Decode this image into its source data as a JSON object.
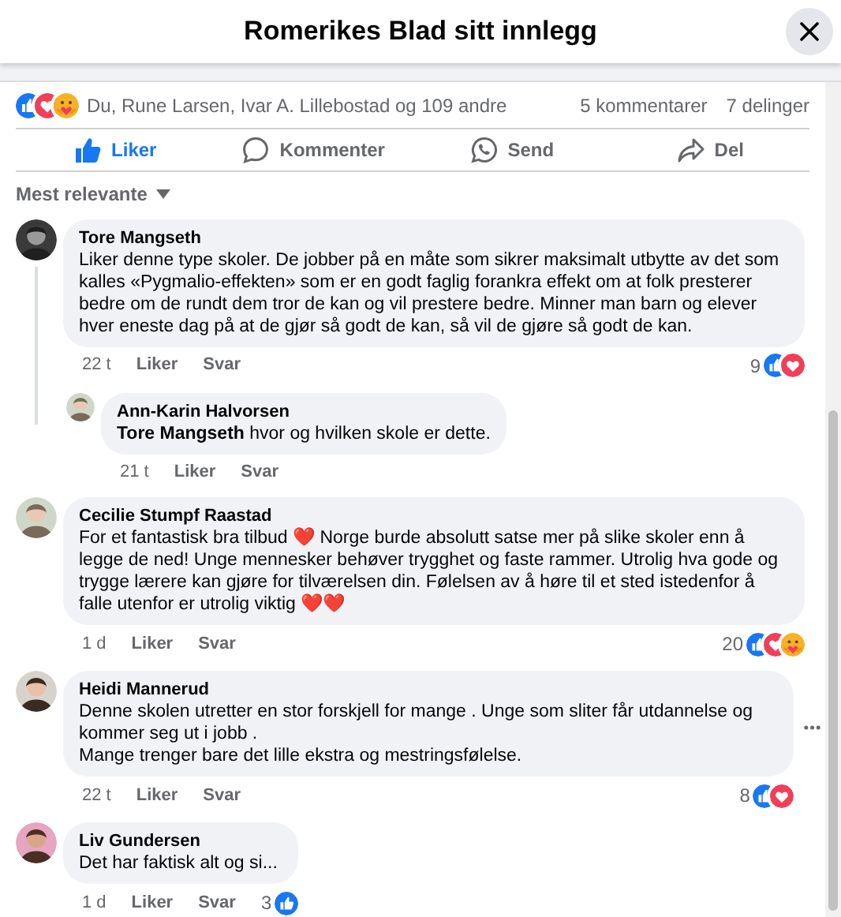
{
  "dialog": {
    "title": "Romerikes Blad sitt innlegg"
  },
  "post": {
    "reactions": [
      {
        "kind": "like"
      },
      {
        "kind": "love"
      },
      {
        "kind": "care"
      }
    ],
    "reacted_by": "Du, Rune Larsen, Ivar A. Lillebostad og 109 andre",
    "comments_count": "5 kommentarer",
    "shares_count": "7 delinger"
  },
  "actions": [
    {
      "kind": "like",
      "label": "Liker",
      "active": true
    },
    {
      "kind": "comment",
      "label": "Kommenter",
      "active": false
    },
    {
      "kind": "send",
      "label": "Send",
      "active": false
    },
    {
      "kind": "share",
      "label": "Del",
      "active": false
    }
  ],
  "sort": {
    "label": "Mest relevante"
  },
  "comments": [
    {
      "kind": "comment",
      "author": "Tore Mangseth",
      "text": "Liker denne type skoler. De jobber på en måte som sikrer maksimalt utbytte av det som kalles «Pygmalio-effekten» som er en godt faglig forankra effekt om at folk presterer bedre om de rundt dem tror de kan og vil prestere bedre. Minner man barn og elever hver eneste dag på at de gjør så godt de kan, så vil de gjøre så godt de kan.",
      "time": "22 t",
      "like_label": "Liker",
      "reply_label": "Svar",
      "reaction_count": "9",
      "reactions": [
        {
          "kind": "like"
        },
        {
          "kind": "love"
        }
      ],
      "show_options": false,
      "replies": [
        {
          "author": "Ann-Karin Halvorsen",
          "text": "**Tore Mangseth** hvor og hvilken skole er dette.",
          "time": "21 t",
          "like_label": "Liker",
          "reply_label": "Svar"
        }
      ]
    },
    {
      "kind": "comment",
      "author": "Cecilie Stumpf Raastad",
      "text": "For et fantastisk bra tilbud ❤️ Norge burde absolutt satse mer på slike skoler enn å legge de ned! Unge mennesker behøver trygghet og faste rammer. Utrolig hva gode og trygge lærere kan gjøre for tilværelsen din. Følelsen av å høre til et sted istedenfor å falle utenfor er utrolig viktig ❤️❤️",
      "time": "1 d",
      "like_label": "Liker",
      "reply_label": "Svar",
      "reaction_count": "20",
      "reactions": [
        {
          "kind": "like"
        },
        {
          "kind": "love"
        },
        {
          "kind": "care"
        }
      ],
      "show_options": false
    },
    {
      "kind": "comment",
      "author": "Heidi Mannerud",
      "text": "Denne skolen utretter en stor forskjell for mange . Unge som sliter får utdannelse og kommer seg ut i jobb .\nMange trenger bare det lille ekstra og mestringsfølelse.",
      "time": "22 t",
      "like_label": "Liker",
      "reply_label": "Svar",
      "reaction_count": "8",
      "reactions": [
        {
          "kind": "like"
        },
        {
          "kind": "love"
        }
      ],
      "show_options": true
    },
    {
      "kind": "comment",
      "author": "Liv Gundersen",
      "text": "Det har faktisk alt og si...",
      "time": "1 d",
      "like_label": "Liker",
      "reply_label": "Svar",
      "reaction_count": "3",
      "reactions": [
        {
          "kind": "like"
        }
      ],
      "show_options": false
    }
  ]
}
